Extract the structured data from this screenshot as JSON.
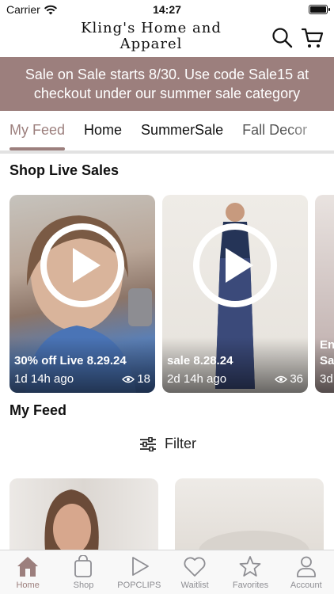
{
  "status": {
    "carrier": "Carrier",
    "time": "14:27"
  },
  "header": {
    "logo_text": "Kling's Home and Apparel"
  },
  "banner": {
    "text": "Sale on Sale starts 8/30. Use code Sale15 at checkout under our summer sale category"
  },
  "tabs": [
    {
      "label": "My Feed",
      "active": true
    },
    {
      "label": "Home"
    },
    {
      "label": "SummerSale"
    },
    {
      "label": "Fall Decor"
    }
  ],
  "live": {
    "title": "Shop Live Sales",
    "cards": [
      {
        "title": "30% off Live 8.29.24",
        "time": "1d 14h ago",
        "views": "18"
      },
      {
        "title": "sale 8.28.24",
        "time": "2d 14h ago",
        "views": "36"
      },
      {
        "title": "En Sa",
        "time": "3d"
      }
    ]
  },
  "feed": {
    "title": "My Feed",
    "filter_label": "Filter"
  },
  "tabbar": [
    {
      "label": "Home",
      "icon": "home-icon",
      "active": true
    },
    {
      "label": "Shop",
      "icon": "bag-icon"
    },
    {
      "label": "POPCLIPS",
      "icon": "play-icon"
    },
    {
      "label": "Waitlist",
      "icon": "heart-icon"
    },
    {
      "label": "Favorites",
      "icon": "star-icon"
    },
    {
      "label": "Account",
      "icon": "person-icon"
    }
  ],
  "colors": {
    "accent": "#9c7f7d",
    "inactive": "#8e8e93"
  }
}
